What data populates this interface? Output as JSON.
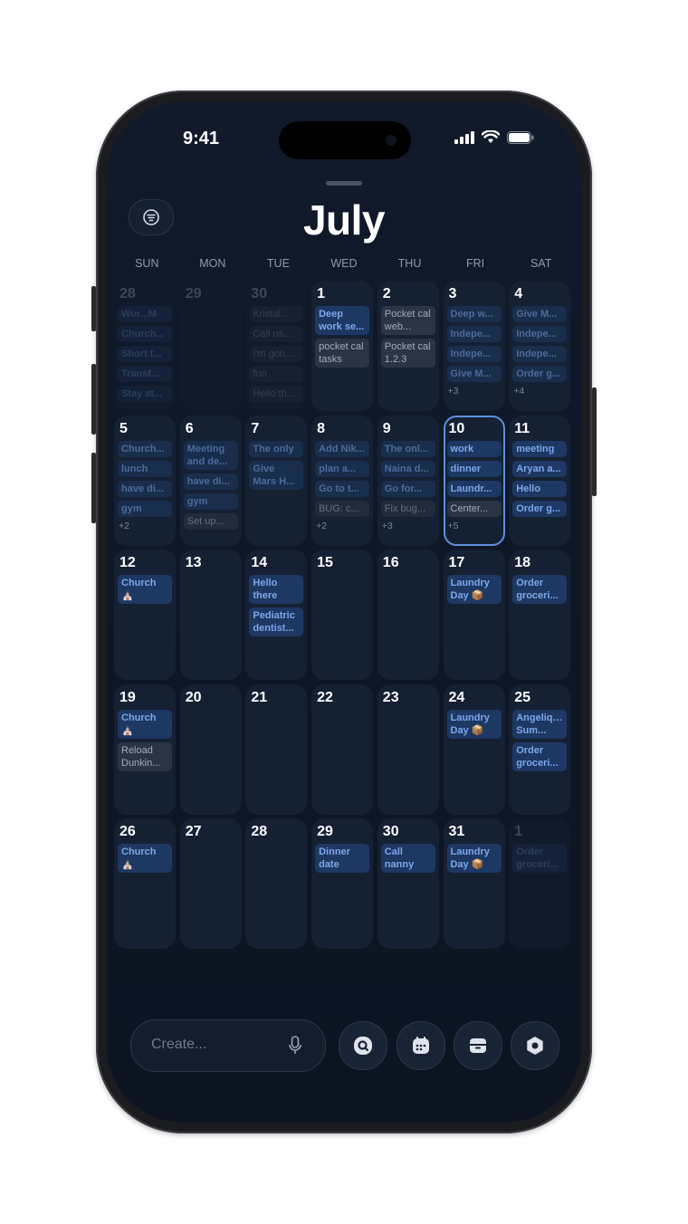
{
  "status_bar": {
    "time": "9:41"
  },
  "header": {
    "month": "July",
    "filter_icon": "filter-icon"
  },
  "weekdays": [
    "SUN",
    "MON",
    "TUE",
    "WED",
    "THU",
    "FRI",
    "SAT"
  ],
  "weeks": [
    [
      {
        "day": "28",
        "other": true,
        "faded": true,
        "events": [
          {
            "t": "Wor...M",
            "c": "blue"
          },
          {
            "t": "Church...",
            "c": "blue"
          },
          {
            "t": "Short t...",
            "c": "blue"
          },
          {
            "t": "Transf...",
            "c": "blue"
          },
          {
            "t": "Stay at...",
            "c": "blue"
          }
        ]
      },
      {
        "day": "29",
        "other": true,
        "faded": true,
        "events": []
      },
      {
        "day": "30",
        "other": true,
        "faded": true,
        "events": [
          {
            "t": "Kristal...",
            "c": "gray"
          },
          {
            "t": "Call us...",
            "c": "gray"
          },
          {
            "t": "I'm gon...",
            "c": "gray"
          },
          {
            "t": "fun",
            "c": "gray"
          },
          {
            "t": "Hello th...",
            "c": "gray"
          }
        ]
      },
      {
        "day": "1",
        "events": [
          {
            "t": "Deep work se...",
            "c": "blue",
            "wrap": true
          },
          {
            "t": "pocket cal tasks",
            "c": "gray",
            "wrap": true
          }
        ]
      },
      {
        "day": "2",
        "events": [
          {
            "t": "Pocket cal web...",
            "c": "gray",
            "wrap": true
          },
          {
            "t": "Pocket cal 1.2.3",
            "c": "gray",
            "wrap": true
          }
        ]
      },
      {
        "day": "3",
        "events": [
          {
            "t": "Deep w...",
            "c": "blue",
            "dim": true
          },
          {
            "t": "Indepe...",
            "c": "blue",
            "dim": true
          },
          {
            "t": "Indepe...",
            "c": "blue",
            "dim": true
          },
          {
            "t": "Give M...",
            "c": "blue",
            "dim": true
          }
        ],
        "more": "+3"
      },
      {
        "day": "4",
        "events": [
          {
            "t": "Give M...",
            "c": "blue",
            "dim": true
          },
          {
            "t": "Indepe...",
            "c": "blue",
            "dim": true
          },
          {
            "t": "Indepe...",
            "c": "blue",
            "dim": true
          },
          {
            "t": "Order g...",
            "c": "blue",
            "dim": true
          }
        ],
        "more": "+4"
      }
    ],
    [
      {
        "day": "5",
        "events": [
          {
            "t": "Church...",
            "c": "blue",
            "dim": true
          },
          {
            "t": "lunch",
            "c": "blue",
            "dim": true
          },
          {
            "t": "have di...",
            "c": "blue",
            "dim": true
          },
          {
            "t": "gym",
            "c": "blue",
            "dim": true
          }
        ],
        "more": "+2"
      },
      {
        "day": "6",
        "events": [
          {
            "t": "Meeting and de...",
            "c": "blue",
            "wrap": true,
            "dim": true
          },
          {
            "t": "have di...",
            "c": "blue",
            "dim": true
          },
          {
            "t": "gym",
            "c": "blue",
            "dim": true
          },
          {
            "t": "Set up...",
            "c": "gray",
            "dim": true
          }
        ]
      },
      {
        "day": "7",
        "events": [
          {
            "t": "The only",
            "c": "blue",
            "dim": true
          },
          {
            "t": "Give Mars H...",
            "c": "blue",
            "wrap": true,
            "dim": true
          }
        ]
      },
      {
        "day": "8",
        "events": [
          {
            "t": "Add Nik...",
            "c": "blue",
            "dim": true
          },
          {
            "t": "plan a...",
            "c": "blue",
            "dim": true
          },
          {
            "t": "Go to t...",
            "c": "blue",
            "dim": true
          },
          {
            "t": "BUG: c...",
            "c": "gray",
            "dim": true
          }
        ],
        "more": "+2"
      },
      {
        "day": "9",
        "events": [
          {
            "t": "The onl...",
            "c": "blue",
            "dim": true
          },
          {
            "t": "Naina d...",
            "c": "blue",
            "dim": true
          },
          {
            "t": "Go for...",
            "c": "blue",
            "dim": true
          },
          {
            "t": "Fix bug...",
            "c": "gray",
            "dim": true
          }
        ],
        "more": "+3"
      },
      {
        "day": "10",
        "today": true,
        "events": [
          {
            "t": "work",
            "c": "blue"
          },
          {
            "t": "dinner",
            "c": "blue"
          },
          {
            "t": "Laundr...",
            "c": "blue"
          },
          {
            "t": "Center...",
            "c": "gray"
          }
        ],
        "more": "+5"
      },
      {
        "day": "11",
        "events": [
          {
            "t": "meeting",
            "c": "blue"
          },
          {
            "t": "Aryan a...",
            "c": "blue"
          },
          {
            "t": "Hello",
            "c": "blue"
          },
          {
            "t": "Order g...",
            "c": "blue"
          }
        ]
      }
    ],
    [
      {
        "day": "12",
        "events": [
          {
            "t": "Church ⛪",
            "c": "blue",
            "wrap": true
          }
        ]
      },
      {
        "day": "13",
        "events": []
      },
      {
        "day": "14",
        "events": [
          {
            "t": "Hello there",
            "c": "blue",
            "wrap": true
          },
          {
            "t": "Pediatric dentist...",
            "c": "blue",
            "wrap": true
          }
        ]
      },
      {
        "day": "15",
        "events": []
      },
      {
        "day": "16",
        "events": []
      },
      {
        "day": "17",
        "events": [
          {
            "t": "Laundry Day 📦",
            "c": "blue",
            "wrap": true
          }
        ]
      },
      {
        "day": "18",
        "events": [
          {
            "t": "Order groceri...",
            "c": "blue",
            "wrap": true
          }
        ]
      }
    ],
    [
      {
        "day": "19",
        "events": [
          {
            "t": "Church ⛪",
            "c": "blue",
            "wrap": true
          },
          {
            "t": "Reload Dunkin...",
            "c": "gray",
            "wrap": true
          }
        ]
      },
      {
        "day": "20",
        "events": []
      },
      {
        "day": "21",
        "events": []
      },
      {
        "day": "22",
        "events": []
      },
      {
        "day": "23",
        "events": []
      },
      {
        "day": "24",
        "events": [
          {
            "t": "Laundry Day 📦",
            "c": "blue",
            "wrap": true
          }
        ]
      },
      {
        "day": "25",
        "events": [
          {
            "t": "Angelique Sum...",
            "c": "blue",
            "wrap": true
          },
          {
            "t": "Order groceri...",
            "c": "blue",
            "wrap": true
          }
        ]
      }
    ],
    [
      {
        "day": "26",
        "events": [
          {
            "t": "Church ⛪",
            "c": "blue",
            "wrap": true
          }
        ]
      },
      {
        "day": "27",
        "events": []
      },
      {
        "day": "28",
        "events": []
      },
      {
        "day": "29",
        "events": [
          {
            "t": "Dinner date",
            "c": "blue",
            "wrap": true
          }
        ]
      },
      {
        "day": "30",
        "events": [
          {
            "t": "Call nanny",
            "c": "blue",
            "wrap": true
          }
        ]
      },
      {
        "day": "31",
        "events": [
          {
            "t": "Laundry Day 📦",
            "c": "blue",
            "wrap": true
          }
        ]
      },
      {
        "day": "1",
        "other": true,
        "faded": true,
        "events": [
          {
            "t": "Order groceri...",
            "c": "blue",
            "wrap": true
          }
        ]
      }
    ]
  ],
  "bottom_bar": {
    "create_placeholder": "Create...",
    "buttons": [
      {
        "name": "search-button",
        "icon": "search-icon"
      },
      {
        "name": "calendar-button",
        "icon": "calendar-icon"
      },
      {
        "name": "inbox-button",
        "icon": "inbox-icon"
      },
      {
        "name": "settings-button",
        "icon": "settings-icon"
      }
    ]
  }
}
